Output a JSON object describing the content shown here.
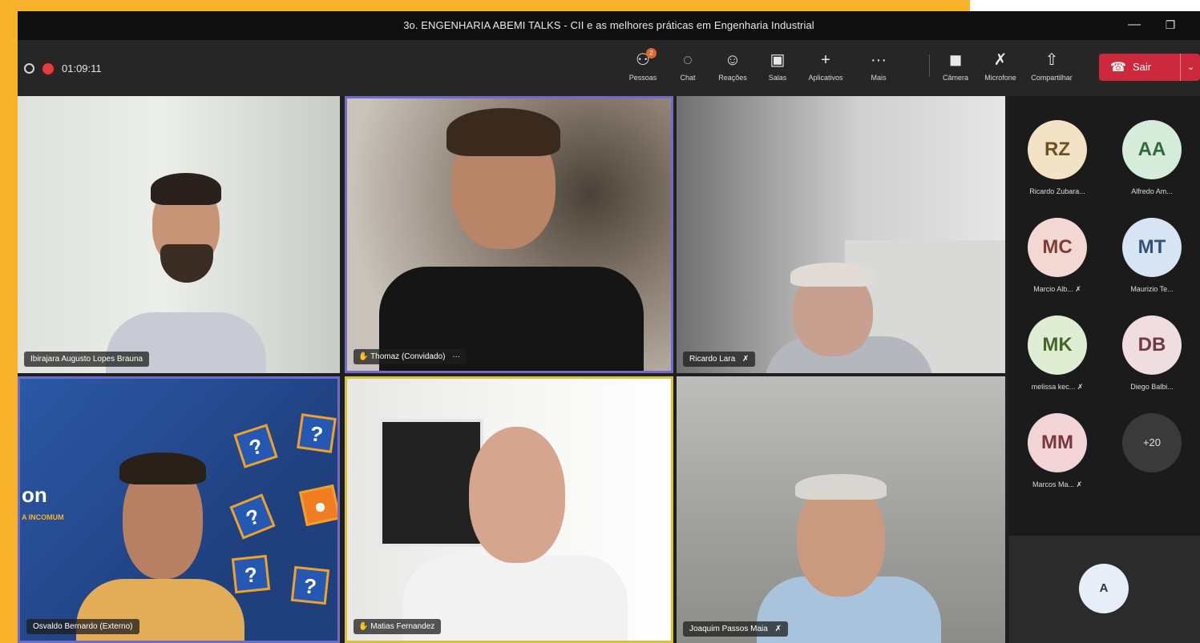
{
  "window": {
    "title": "3o. ENGENHARIA ABEMI TALKS - CII e as melhores práticas em Engenharia Industrial",
    "minimize_glyph": "—",
    "maximize_glyph": "❐"
  },
  "toolbar": {
    "timer": "01:09:11",
    "people_badge": "2",
    "items": [
      {
        "label": "Pessoas",
        "icon": "people-icon",
        "glyph": "⚇"
      },
      {
        "label": "Chat",
        "icon": "chat-icon",
        "glyph": "◌"
      },
      {
        "label": "Reações",
        "icon": "reactions-icon",
        "glyph": "☺"
      },
      {
        "label": "Salas",
        "icon": "rooms-icon",
        "glyph": "▣"
      },
      {
        "label": "Aplicativos",
        "icon": "plus-icon",
        "glyph": "+"
      },
      {
        "label": "Mais",
        "icon": "more-icon",
        "glyph": "···"
      },
      {
        "label": "Câmera",
        "icon": "camera-off-icon",
        "glyph": "◼"
      },
      {
        "label": "Microfone",
        "icon": "mic-off-icon",
        "glyph": "✗"
      },
      {
        "label": "Compartilhar",
        "icon": "share-icon",
        "glyph": "⇧"
      }
    ],
    "leave_label": "Sair"
  },
  "tiles": [
    {
      "name": "Ibirajara Augusto Lopes Brauna"
    },
    {
      "name": "Thomaz (Convidado)",
      "raised_hand": true,
      "more": "···"
    },
    {
      "name": "Ricardo Lara",
      "muted": true
    },
    {
      "name": "Osvaldo Bernardo (Externo)"
    },
    {
      "name": "Matias Fernandez",
      "raised_hand": true
    },
    {
      "name": "Joaquim Passos Maia",
      "muted": true
    }
  ],
  "background_text": {
    "brand": "on",
    "tagline": "A INCOMUM"
  },
  "roster": [
    {
      "initials": "RZ",
      "name": "Ricardo Zubara...",
      "bg": "#f3e3c6",
      "fg": "#6e5120"
    },
    {
      "initials": "AA",
      "name": "Alfredo Am...",
      "bg": "#d4ecd9",
      "fg": "#2e6b3b"
    },
    {
      "initials": "MC",
      "name": "Marcio Alb...",
      "bg": "#f2d7d2",
      "fg": "#7d3f35",
      "muted": true
    },
    {
      "initials": "MT",
      "name": "Maurizio Te...",
      "bg": "#d7e4f3",
      "fg": "#34507a"
    },
    {
      "initials": "MK",
      "name": "melissa kec...",
      "bg": "#dfeed2",
      "fg": "#45652b",
      "muted": true
    },
    {
      "initials": "DB",
      "name": "Diego Balbi...",
      "bg": "#f0dde0",
      "fg": "#6e3a44"
    },
    {
      "initials": "MM",
      "name": "Marcos Ma...",
      "bg": "#f2d3d6",
      "fg": "#7a3640",
      "muted": true
    },
    {
      "initials": "+20",
      "name": "",
      "bg": "#3a3a3a",
      "fg": "#e0e0e0"
    }
  ],
  "self_avatar": "A",
  "colors": {
    "accent_orange": "#f7b32b",
    "leave_red": "#cc2a3c",
    "active_speaker": "#d8c23c",
    "pinned": "#6f6bc7"
  }
}
